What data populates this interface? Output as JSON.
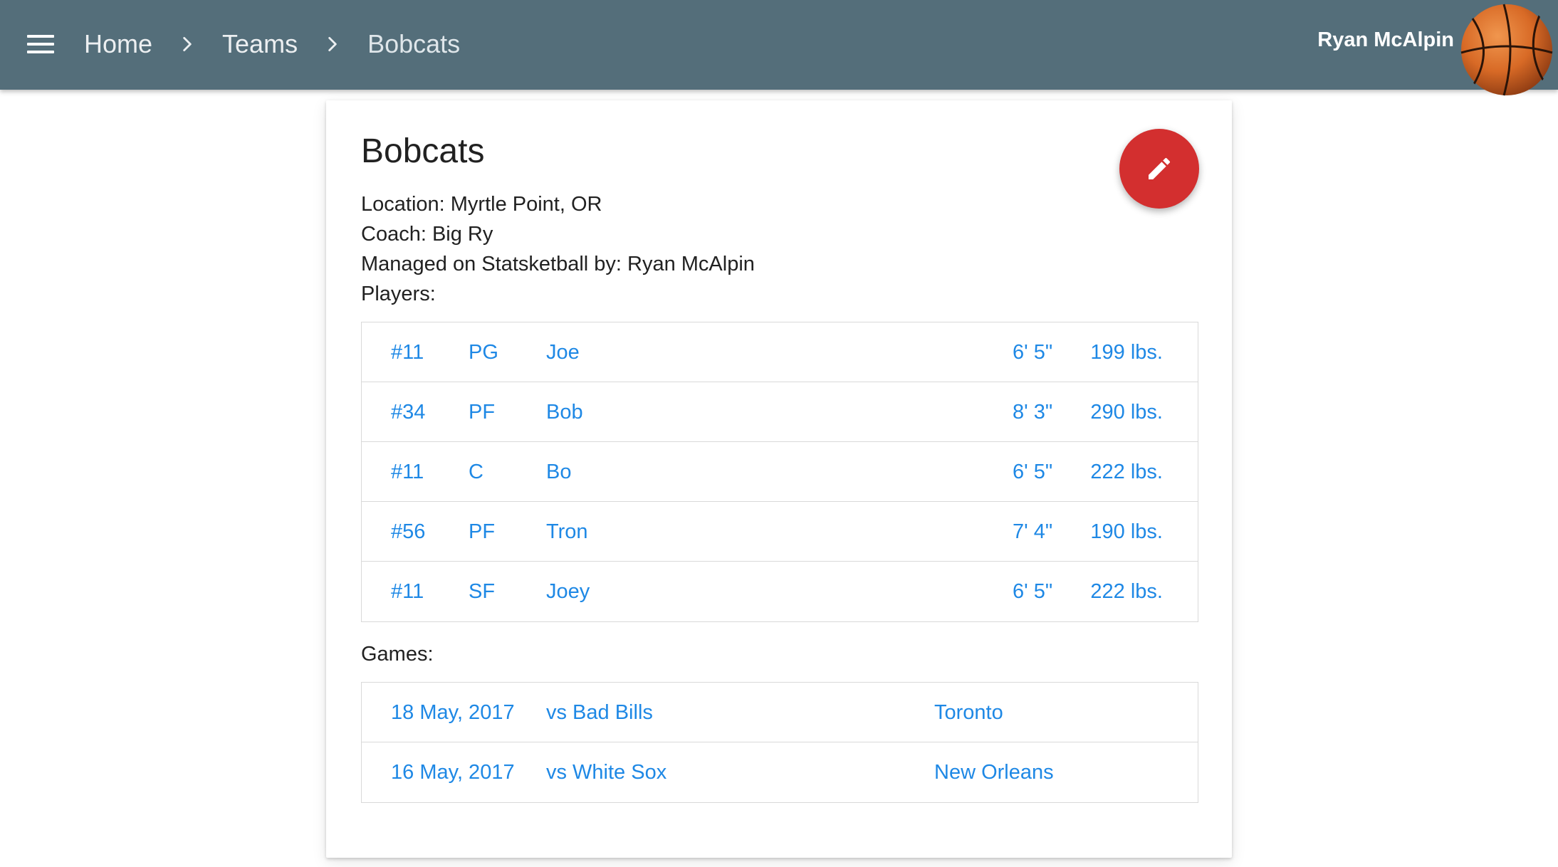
{
  "header": {
    "breadcrumb": [
      "Home",
      "Teams",
      "Bobcats"
    ],
    "user_name": "Ryan McAlpin",
    "bar_color": "#546e7a"
  },
  "icons": {
    "menu": "menu-icon",
    "separator": "chevron-right-icon",
    "edit": "pencil-icon",
    "avatar": "basketball-icon"
  },
  "team": {
    "name": "Bobcats",
    "location": "Location: Myrtle Point, OR",
    "coach": "Coach: Big Ry",
    "managed_by": "Managed on Statsketball by: Ryan McAlpin",
    "players_label": "Players:",
    "games_label": "Games:"
  },
  "players": [
    {
      "number": "#11",
      "position": "PG",
      "name": "Joe",
      "height": "6' 5\"",
      "weight": "199 lbs."
    },
    {
      "number": "#34",
      "position": "PF",
      "name": "Bob",
      "height": "8' 3\"",
      "weight": "290 lbs."
    },
    {
      "number": "#11",
      "position": "C",
      "name": "Bo",
      "height": "6' 5\"",
      "weight": "222 lbs."
    },
    {
      "number": "#56",
      "position": "PF",
      "name": "Tron",
      "height": "7' 4\"",
      "weight": "190 lbs."
    },
    {
      "number": "#11",
      "position": "SF",
      "name": "Joey",
      "height": "6' 5\"",
      "weight": "222 lbs."
    }
  ],
  "games": [
    {
      "date": "18 May, 2017",
      "opponent": "vs Bad Bills",
      "location": "Toronto"
    },
    {
      "date": "16 May, 2017",
      "opponent": "vs White Sox",
      "location": "New Orleans"
    }
  ],
  "colors": {
    "link": "#1e88e5",
    "fab": "#d32f2f",
    "divider": "#d9d9d9"
  }
}
